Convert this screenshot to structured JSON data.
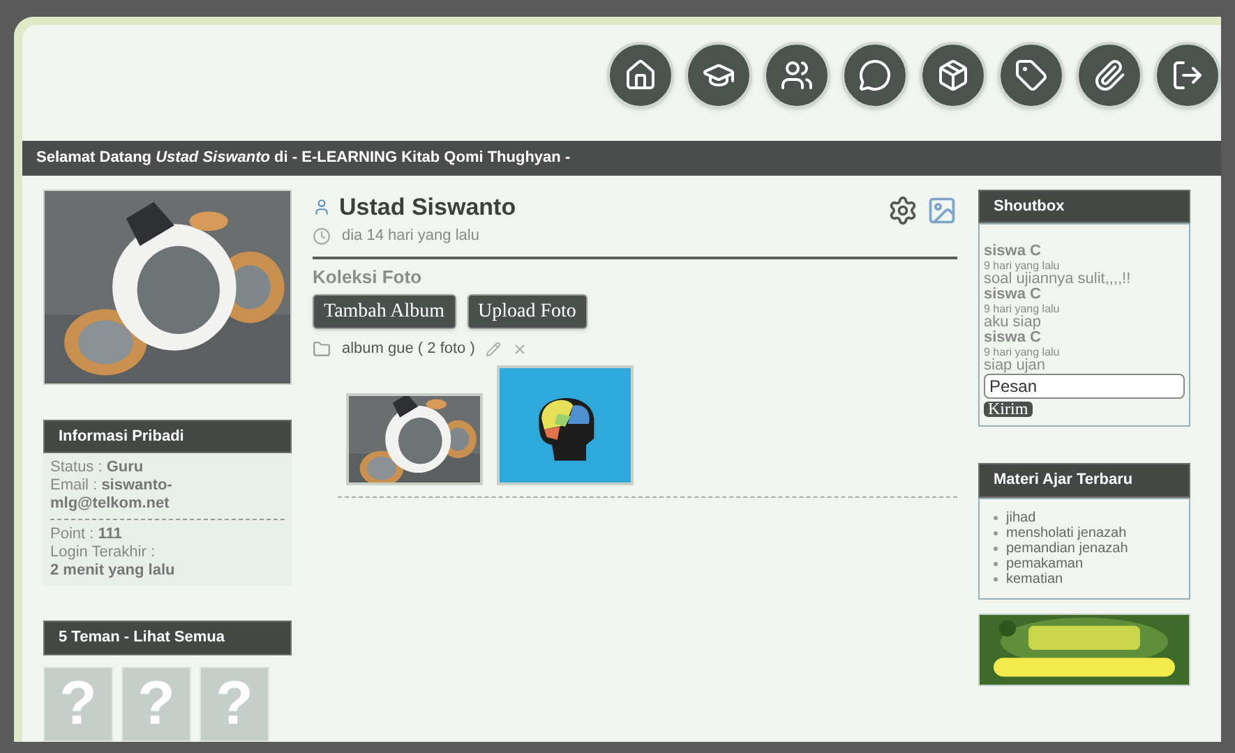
{
  "nav": [
    {
      "kind": "home"
    },
    {
      "kind": "cap"
    },
    {
      "kind": "users"
    },
    {
      "kind": "chat"
    },
    {
      "kind": "box"
    },
    {
      "kind": "tag"
    },
    {
      "kind": "clip"
    },
    {
      "kind": "exit"
    }
  ],
  "welcome": "Selamat Datang *Ustad Siswanto* di - E-LEARNING Kitab Qomi Thughyan -",
  "info": {
    "title": "Informasi Pribadi",
    "groups": [
      [
        {
          "label": "Status :",
          "value": "Guru",
          "block": false
        },
        {
          "label": "Email :",
          "value": "siswanto-mlg@telkom.net",
          "block": false
        }
      ],
      [
        {
          "label": "Point :",
          "value": "111",
          "block": false
        },
        {
          "label": "Login Terakhir :",
          "value": "2 menit yang lalu",
          "block": true
        }
      ]
    ]
  },
  "friends": {
    "title": "5 Teman - Lihat Semua",
    "items": [
      "?",
      "?",
      "?"
    ]
  },
  "profile": {
    "name": "Ustad Siswanto",
    "time": "dia 14 hari yang lalu"
  },
  "gallery": {
    "title": "Koleksi Foto",
    "buttons": [
      "Tambah Album",
      "Upload Foto"
    ],
    "album": "album gue ( 2 foto )",
    "photos": [
      {
        "kind": "bike"
      },
      {
        "kind": "brain"
      }
    ]
  },
  "shoutbox": {
    "title": "Shoutbox",
    "messages": [
      {
        "user": "siswa C",
        "time": "9 hari yang lalu",
        "text": "soal ujiannya sulit,,,,!!"
      },
      {
        "user": "siswa C",
        "time": "9 hari yang lalu",
        "text": "aku siap"
      },
      {
        "user": "siswa C",
        "time": "9 hari yang lalu",
        "text": "siap ujan"
      }
    ],
    "placeholder": "Pesan",
    "button": "Kirim"
  },
  "materi": {
    "title": "Materi Ajar Terbaru",
    "items": [
      "jihad",
      "mensholati jenazah",
      "pemandian jenazah",
      "pemakaman",
      "kematian"
    ]
  }
}
